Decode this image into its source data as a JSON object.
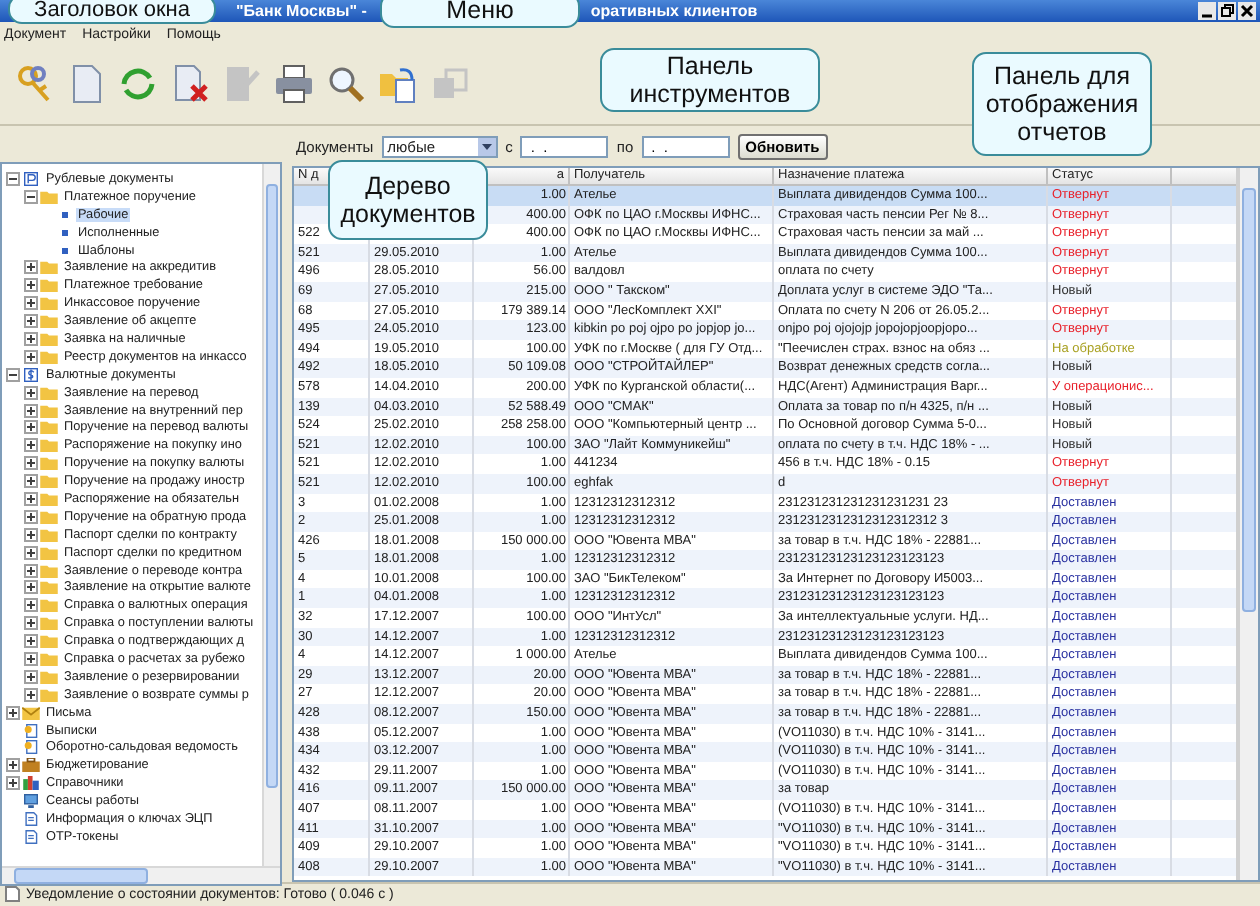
{
  "window": {
    "title_parts": [
      "\"Банк Москвы\" - ",
      "оративных клиентов"
    ]
  },
  "menu": [
    "Документ",
    "Настройки",
    "Помощь"
  ],
  "toolbar": [
    {
      "disabled": false
    },
    {
      "disabled": false
    },
    {
      "disabled": false
    },
    {
      "disabled": false
    },
    {
      "disabled": true
    },
    {
      "disabled": false
    },
    {
      "disabled": false
    },
    {
      "disabled": false
    },
    {
      "disabled": true
    }
  ],
  "tree": [
    {
      "label": "Рублевые документы",
      "kind": "rub",
      "expanded": true,
      "children": [
        {
          "label": "Платежное поручение",
          "kind": "folder",
          "expanded": true,
          "children": [
            {
              "label": "Рабочие",
              "kind": "leaf",
              "selected": true
            },
            {
              "label": "Исполненные",
              "kind": "leaf",
              "selected": false
            },
            {
              "label": "Шаблоны",
              "kind": "leaf",
              "selected": false
            }
          ]
        },
        {
          "label": "Заявление на аккредитив",
          "kind": "folder",
          "expanded": false
        },
        {
          "label": "Платежное требование",
          "kind": "folder",
          "expanded": false
        },
        {
          "label": "Инкассовое поручение",
          "kind": "folder",
          "expanded": false
        },
        {
          "label": "Заявление об акцепте",
          "kind": "folder",
          "expanded": false
        },
        {
          "label": "Заявка на наличные",
          "kind": "folder",
          "expanded": false
        },
        {
          "label": "Реестр документов на инкассо",
          "kind": "folder",
          "expanded": false
        }
      ]
    },
    {
      "label": "Валютные документы",
      "kind": "val",
      "expanded": true,
      "children": [
        {
          "label": "Заявление на перевод",
          "kind": "folder",
          "expanded": false
        },
        {
          "label": "Заявление на внутренний пер",
          "kind": "folder",
          "expanded": false
        },
        {
          "label": "Поручение на перевод валюты",
          "kind": "folder",
          "expanded": false
        },
        {
          "label": "Распоряжение на покупку ино",
          "kind": "folder",
          "expanded": false
        },
        {
          "label": "Поручение на покупку валюты",
          "kind": "folder",
          "expanded": false
        },
        {
          "label": "Поручение на продажу иностр",
          "kind": "folder",
          "expanded": false
        },
        {
          "label": "Распоряжение на обязательн",
          "kind": "folder",
          "expanded": false
        },
        {
          "label": "Поручение на обратную прода",
          "kind": "folder",
          "expanded": false
        },
        {
          "label": "Паспорт сделки по контракту",
          "kind": "folder",
          "expanded": false
        },
        {
          "label": "Паспорт сделки по кредитном",
          "kind": "folder",
          "expanded": false
        },
        {
          "label": "Заявление о переводе контра",
          "kind": "folder",
          "expanded": false
        },
        {
          "label": "Заявление на открытие валюте",
          "kind": "folder",
          "expanded": false
        },
        {
          "label": "Справка о валютных операция",
          "kind": "folder",
          "expanded": false
        },
        {
          "label": "Справка о поступлении валюты",
          "kind": "folder",
          "expanded": false
        },
        {
          "label": "Справка о подтверждающих д",
          "kind": "folder",
          "expanded": false
        },
        {
          "label": "Справка о расчетах за рубежо",
          "kind": "folder",
          "expanded": false
        },
        {
          "label": "Заявление о резервировании",
          "kind": "folder",
          "expanded": false
        },
        {
          "label": "Заявление о возврате суммы р",
          "kind": "folder",
          "expanded": false
        }
      ]
    },
    {
      "label": "Письма",
      "kind": "mail",
      "expanded": false
    },
    {
      "label": "Выписки",
      "kind": "report"
    },
    {
      "label": "Оборотно-сальдовая ведомость",
      "kind": "report"
    },
    {
      "label": "Бюджетирование",
      "kind": "budget",
      "expanded": false
    },
    {
      "label": "Справочники",
      "kind": "dir",
      "expanded": false
    },
    {
      "label": "Сеансы работы",
      "kind": "session"
    },
    {
      "label": "Информация о ключах ЭЦП",
      "kind": "doc"
    },
    {
      "label": "ОТР-токены",
      "kind": "doc"
    }
  ],
  "filter": {
    "label": "Документы",
    "select": "любые",
    "from_label": "с",
    "from_value": ".  .",
    "to_label": "по",
    "to_value": ".  .",
    "button": "Обновить"
  },
  "table": {
    "columns": [
      {
        "label": "N д"
      },
      {},
      {
        "label": "а"
      },
      {
        "label": "Получатель"
      },
      {
        "label": "Назначение платежа"
      },
      {
        "label": "Статус"
      }
    ],
    "rows": [
      {
        "selected": true,
        "amount": "1.00",
        "recipient": "Ателье",
        "purpose": "Выплата дивидендов Сумма 100...",
        "status": "Отвернут",
        "color": "#e8202a"
      },
      {
        "selected": false,
        "amount": "400.00",
        "recipient": "ОФК по ЦАО  г.Москвы  ИФНС...",
        "purpose": "Страховая часть пенсии Рег № 8...",
        "status": "Отвернут",
        "color": "#e8202a"
      },
      {
        "selected": false,
        "num": "522",
        "amount": "400.00",
        "recipient": "ОФК по ЦАО  г.Москвы  ИФНС...",
        "purpose": "Страховая часть пенсии за май  ...",
        "status": "Отвернут",
        "color": "#e8202a"
      },
      {
        "selected": false,
        "num": "521",
        "date": "29.05.2010",
        "amount": "1.00",
        "recipient": "Ателье",
        "purpose": "Выплата дивидендов Сумма 100...",
        "status": "Отвернут",
        "color": "#e8202a"
      },
      {
        "selected": false,
        "num": "496",
        "date": "28.05.2010",
        "amount": "56.00",
        "recipient": "валдовл",
        "purpose": "оплата по счету",
        "status": "Отвернут",
        "color": "#e8202a"
      },
      {
        "selected": false,
        "num": "69",
        "date": "27.05.2010",
        "amount": "215.00",
        "recipient": "ООО \" Такском\"",
        "purpose": "Доплата услуг в системе ЭДО \"Та...",
        "status": "Новый",
        "color": "#303030"
      },
      {
        "selected": false,
        "num": "68",
        "date": "27.05.2010",
        "amount": "179 389.14",
        "recipient": "ООО \"ЛесКомплект XXI\"",
        "purpose": "Оплата по счету N 206 от 26.05.2...",
        "status": "Отвернут",
        "color": "#e8202a"
      },
      {
        "selected": false,
        "num": "495",
        "date": "24.05.2010",
        "amount": "123.00",
        "recipient": "kibkin po poj ojpo po jopjop jo...",
        "purpose": "onjpo poj ojojojp jopojopjoopjopo...",
        "status": "Отвернут",
        "color": "#e8202a"
      },
      {
        "selected": false,
        "num": "494",
        "date": "19.05.2010",
        "amount": "100.00",
        "recipient": "УФК по г.Москве ( для ГУ Отд...",
        "purpose": "\"Пеечислен страх. взнос на обяз ...",
        "status": "На обработке",
        "color": "#a8a020"
      },
      {
        "selected": false,
        "num": "492",
        "date": "18.05.2010",
        "amount": "50 109.08",
        "recipient": "ООО \"СТРОЙТАЙЛЕР\"",
        "purpose": "Возврат денежных средств согла...",
        "status": "Новый",
        "color": "#303030"
      },
      {
        "selected": false,
        "num": "578",
        "date": "14.04.2010",
        "amount": "200.00",
        "recipient": "УФК по Курганской области(...",
        "purpose": "НДС(Агент) Администрация Варг...",
        "status": "У операционис...",
        "color": "#e8202a"
      },
      {
        "selected": false,
        "num": "139",
        "date": "04.03.2010",
        "amount": "52 588.49",
        "recipient": "ООО \"СМАК\"",
        "purpose": "Оплата за товар по п/н 4325, п/н ...",
        "status": "Новый",
        "color": "#303030"
      },
      {
        "selected": false,
        "num": "524",
        "date": "25.02.2010",
        "amount": "258 258.00",
        "recipient": "ООО \"Компьютерный центр ...",
        "purpose": "По Основной договор Сумма 5-0...",
        "status": "Новый",
        "color": "#303030"
      },
      {
        "selected": false,
        "num": "521",
        "date": "12.02.2010",
        "amount": "100.00",
        "recipient": "ЗАО \"Лайт Коммуникейш\"",
        "purpose": "оплата по счету в т.ч. НДС 18% - ...",
        "status": "Новый",
        "color": "#303030"
      },
      {
        "selected": false,
        "num": "521",
        "date": "12.02.2010",
        "amount": "1.00",
        "recipient": "441234",
        "purpose": "456 в т.ч. НДС 18% - 0.15",
        "status": "Отвернут",
        "color": "#e8202a"
      },
      {
        "selected": false,
        "num": "521",
        "date": "12.02.2010",
        "amount": "100.00",
        "recipient": "eghfak",
        "purpose": "d",
        "status": "Отвернут",
        "color": "#e8202a"
      },
      {
        "selected": false,
        "num": "3",
        "date": "01.02.2008",
        "amount": "1.00",
        "recipient": "12312312312312",
        "purpose": "231231231231231231231 23",
        "status": "Доставлен",
        "color": "#2830a0"
      },
      {
        "selected": false,
        "num": "2",
        "date": "25.01.2008",
        "amount": "1.00",
        "recipient": "12312312312312",
        "purpose": "2312312312312312312312 3",
        "status": "Доставлен",
        "color": "#2830a0"
      },
      {
        "selected": false,
        "num": "426",
        "date": "18.01.2008",
        "amount": "150 000.00",
        "recipient": "ООО \"Ювента МВА\"",
        "purpose": "за товар  в т.ч. НДС 18% - 22881...",
        "status": "Доставлен",
        "color": "#2830a0"
      },
      {
        "selected": false,
        "num": "5",
        "date": "18.01.2008",
        "amount": "1.00",
        "recipient": "12312312312312",
        "purpose": "23123123123123123123123",
        "status": "Доставлен",
        "color": "#2830a0"
      },
      {
        "selected": false,
        "num": "4",
        "date": "10.01.2008",
        "amount": "100.00",
        "recipient": "ЗАО \"БикТелеком\"",
        "purpose": "За Интернет по Договору И5003...",
        "status": "Доставлен",
        "color": "#2830a0"
      },
      {
        "selected": false,
        "num": "1",
        "date": "04.01.2008",
        "amount": "1.00",
        "recipient": "12312312312312",
        "purpose": "23123123123123123123123",
        "status": "Доставлен",
        "color": "#2830a0"
      },
      {
        "selected": false,
        "num": "32",
        "date": "17.12.2007",
        "amount": "100.00",
        "recipient": "ООО \"ИнтУсл\"",
        "purpose": "За интеллектуальные услуги. НД...",
        "status": "Доставлен",
        "color": "#2830a0"
      },
      {
        "selected": false,
        "num": "30",
        "date": "14.12.2007",
        "amount": "1.00",
        "recipient": "12312312312312",
        "purpose": "23123123123123123123123",
        "status": "Доставлен",
        "color": "#2830a0"
      },
      {
        "selected": false,
        "num": "4",
        "date": "14.12.2007",
        "amount": "1 000.00",
        "recipient": "Ателье",
        "purpose": "Выплата дивидендов Сумма 100...",
        "status": "Доставлен",
        "color": "#2830a0"
      },
      {
        "selected": false,
        "num": "29",
        "date": "13.12.2007",
        "amount": "20.00",
        "recipient": "ООО \"Ювента МВА\"",
        "purpose": "за товар  в т.ч. НДС 18% - 22881...",
        "status": "Доставлен",
        "color": "#2830a0"
      },
      {
        "selected": false,
        "num": "27",
        "date": "12.12.2007",
        "amount": "20.00",
        "recipient": "ООО \"Ювента МВА\"",
        "purpose": "за товар  в т.ч. НДС 18% - 22881...",
        "status": "Доставлен",
        "color": "#2830a0"
      },
      {
        "selected": false,
        "num": "428",
        "date": "08.12.2007",
        "amount": "150.00",
        "recipient": "ООО \"Ювента МВА\"",
        "purpose": "за товар  в т.ч. НДС 18% - 22881...",
        "status": "Доставлен",
        "color": "#2830a0"
      },
      {
        "selected": false,
        "num": "438",
        "date": "05.12.2007",
        "amount": "1.00",
        "recipient": "ООО \"Ювента МВА\"",
        "purpose": "(VO11030)  в т.ч. НДС 10% - 3141...",
        "status": "Доставлен",
        "color": "#2830a0"
      },
      {
        "selected": false,
        "num": "434",
        "date": "03.12.2007",
        "amount": "1.00",
        "recipient": "ООО \"Ювента МВА\"",
        "purpose": "(VO11030)  в т.ч. НДС 10% - 3141...",
        "status": "Доставлен",
        "color": "#2830a0"
      },
      {
        "selected": false,
        "num": "432",
        "date": "29.11.2007",
        "amount": "1.00",
        "recipient": "ООО \"Ювента МВА\"",
        "purpose": "(VO11030)  в т.ч. НДС 10% - 3141...",
        "status": "Доставлен",
        "color": "#2830a0"
      },
      {
        "selected": false,
        "num": "416",
        "date": "09.11.2007",
        "amount": "150 000.00",
        "recipient": "ООО \"Ювента МВА\"",
        "purpose": "за товар",
        "status": "Доставлен",
        "color": "#2830a0"
      },
      {
        "selected": false,
        "num": "407",
        "date": "08.11.2007",
        "amount": "1.00",
        "recipient": "ООО \"Ювента МВА\"",
        "purpose": "(VO11030)  в т.ч. НДС 10% - 3141...",
        "status": "Доставлен",
        "color": "#2830a0"
      },
      {
        "selected": false,
        "num": "411",
        "date": "31.10.2007",
        "amount": "1.00",
        "recipient": "ООО \"Ювента МВА\"",
        "purpose": "\"VO11030)  в т.ч. НДС 10% - 3141...",
        "status": "Доставлен",
        "color": "#2830a0"
      },
      {
        "selected": false,
        "num": "409",
        "date": "29.10.2007",
        "amount": "1.00",
        "recipient": "ООО \"Ювента МВА\"",
        "purpose": "\"VO11030)  в т.ч. НДС 10% - 3141...",
        "status": "Доставлен",
        "color": "#2830a0"
      },
      {
        "selected": false,
        "num": "408",
        "date": "29.10.2007",
        "amount": "1.00",
        "recipient": "ООО \"Ювента МВА\"",
        "purpose": "\"VO11030)  в т.ч. НДС 10% - 3141...",
        "status": "Доставлен",
        "color": "#2830a0"
      }
    ]
  },
  "status_bar": "Уведомление о состоянии документов: Готово ( 0.046 с )",
  "callouts": [
    "Заголовок окна",
    "Меню",
    "Панель инструментов",
    "Панель для отображения отчетов",
    "Дерево документов"
  ]
}
